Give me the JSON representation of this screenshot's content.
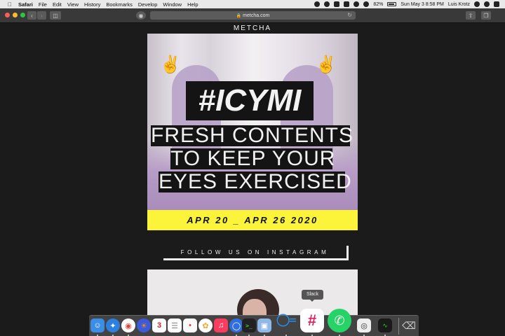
{
  "menubar": {
    "items": [
      "Safari",
      "File",
      "Edit",
      "View",
      "History",
      "Bookmarks",
      "Develop",
      "Window",
      "Help"
    ],
    "battery": "82%",
    "clock": "Sun May 3  8:58 PM",
    "user": "Luis Krotz"
  },
  "browser": {
    "url": "metcha.com"
  },
  "page": {
    "brand": "METCHA",
    "headline": "#ICYMI",
    "line1": "FRESH CONTENTS",
    "line2": "TO KEEP YOUR",
    "line3": "EYES EXERCISED",
    "dates": "APR 20 _ APR 26 2020",
    "follow": "FOLLOW US ON INSTAGRAM"
  },
  "dock": {
    "tooltip": "Slack",
    "calendar_day": "3",
    "apps": [
      "finder-icon",
      "safari-icon",
      "chrome-icon",
      "firefox-icon",
      "calendar-icon",
      "notes-icon",
      "reminders-icon",
      "photos-icon",
      "music-icon",
      "signal-icon",
      "terminal-icon",
      "preview-icon",
      "vscode-icon",
      "slack-icon",
      "whatsapp-icon",
      "screenshot-icon",
      "activity-monitor-icon",
      "trash-icon"
    ]
  },
  "colors": {
    "accent_yellow": "#fbf43a",
    "page_bg": "#1b1b1b"
  }
}
